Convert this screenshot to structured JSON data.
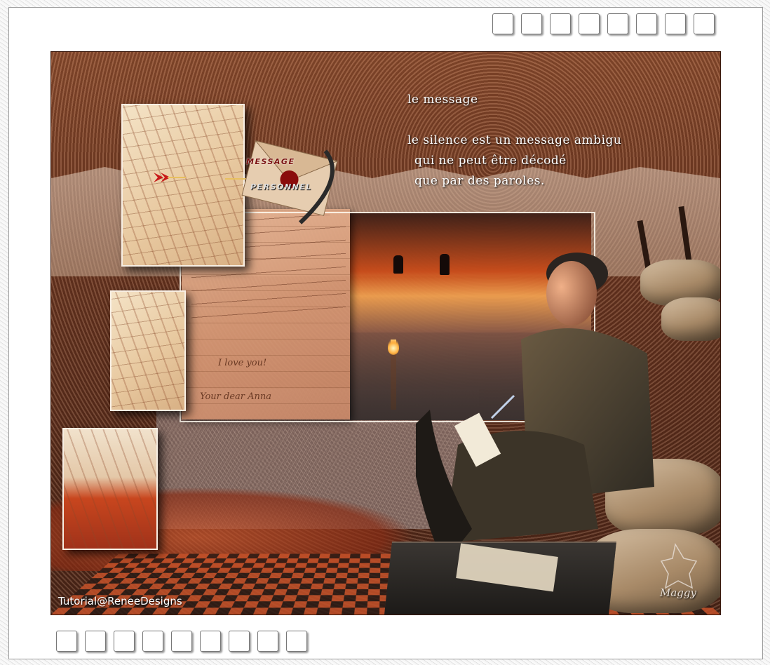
{
  "page": {
    "outer_squares_top_count": 8,
    "outer_squares_bottom_count": 9
  },
  "artwork": {
    "heading": "le message",
    "quote_lines": [
      "le silence est un message ambigu",
      "qui ne peut être décodé",
      "que par des paroles."
    ],
    "envelope_label_top": "MESSAGE",
    "envelope_label_bottom": "PERSONNEL",
    "letter_closing_1": "I love you!",
    "letter_closing_2": "Your dear Anna",
    "credit": "Tutorial@ReneeDesigns",
    "signature": "Maggy"
  },
  "colors": {
    "frame": "#ffffff",
    "artwork_base": "#5a2a18",
    "accent_red": "#c45028",
    "text_light": "#ffffff"
  },
  "icons": [
    "red-arrow-icon",
    "gold-arrow-icon",
    "wax-seal-icon",
    "feather-icon",
    "wolf-signature-icon"
  ]
}
